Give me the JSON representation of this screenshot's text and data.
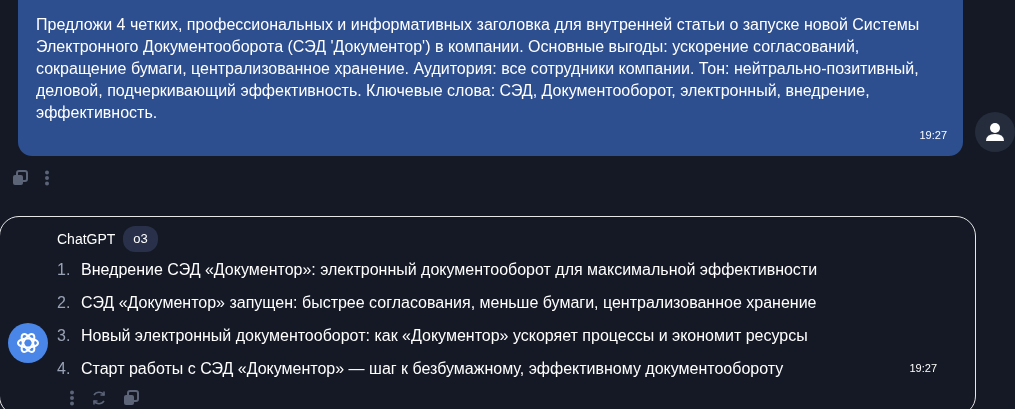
{
  "user_message": {
    "text": "Предложи 4 четких, профессиональных и информативных заголовка для внутренней статьи о запуске новой Системы Электронного Документооборота (СЭД 'Документор') в компании. Основные выгоды: ускорение согласований, сокращение бумаги, централизованное хранение. Аудитория: все сотрудники компании. Тон: нейтрально-позитивный, деловой, подчеркивающий эффективность. Ключевые слова: СЭД, Документооборот, электронный, внедрение, эффективность.",
    "time": "19:27"
  },
  "assistant_message": {
    "sender": "ChatGPT",
    "model": "o3",
    "time": "19:27",
    "items": [
      {
        "number": "1.",
        "text": "Внедрение СЭД «Документор»: электронный документооборот для максимальной эффективности"
      },
      {
        "number": "2.",
        "text": "СЭД «Документор» запущен: быстрее согласования, меньше бумаги, централизованное хранение"
      },
      {
        "number": "3.",
        "text": "Новый электронный документооборот: как «Документор» ускоряет процессы и экономит ресурсы"
      },
      {
        "number": "4.",
        "text": "Старт работы с СЭД «Документор» — шаг к безбумажному, эффективному документообороту"
      }
    ]
  }
}
